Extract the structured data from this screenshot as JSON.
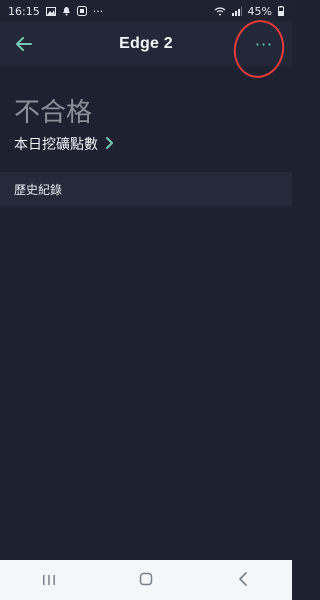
{
  "statusbar": {
    "time": "16:15",
    "more": "···",
    "battery": "45%"
  },
  "appbar": {
    "title": "Edge 2",
    "more_label": "···"
  },
  "main": {
    "status_text": "不合格",
    "daily_link_label": "本日挖礦點數",
    "history_label": "歷史紀錄"
  },
  "navbar": {
    "recent_icon": "recent-apps-icon",
    "home_icon": "home-icon",
    "back_icon": "back-icon"
  },
  "colors": {
    "background": "#1e2130",
    "appbar": "#232838",
    "accent": "#77c6b4",
    "annotation": "#e23b3b",
    "muted_text": "#8b8f99"
  }
}
